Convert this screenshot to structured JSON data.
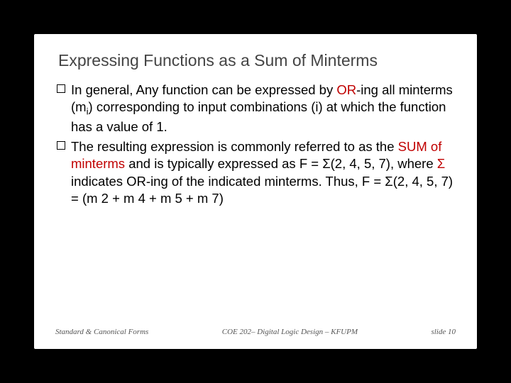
{
  "slide": {
    "title": "Expressing Functions as a Sum of Minterms",
    "bullets": [
      {
        "parts": [
          {
            "t": "In general, Any function can be expressed by "
          },
          {
            "t": "OR",
            "red": true
          },
          {
            "t": "-ing all minterms (m"
          },
          {
            "t": "i",
            "sub": true
          },
          {
            "t": ") corresponding to input combinations (i) at which the function has a value of 1."
          }
        ]
      },
      {
        "parts": [
          {
            "t": "The resulting expression is commonly referred to as the "
          },
          {
            "t": "SUM of minterms",
            "red": true
          },
          {
            "t": " and is typically expressed as F = Σ(2, 4, 5, 7), where "
          },
          {
            "t": "Σ",
            "red": true
          },
          {
            "t": " indicates OR-ing of the indicated minterms. Thus, F = Σ(2, 4, 5, 7) = (m 2 + m 4 + m 5 + m 7)"
          }
        ]
      }
    ],
    "footer": {
      "left": "Standard & Canonical Forms",
      "center": "COE 202– Digital Logic Design – KFUPM",
      "right": "slide 10"
    }
  }
}
